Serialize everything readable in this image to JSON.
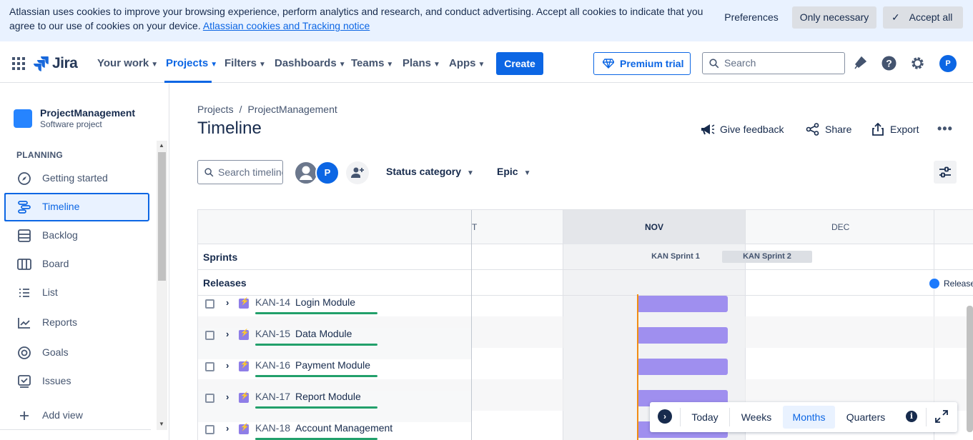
{
  "cookie_banner": {
    "text": "Atlassian uses cookies to improve your browsing experience, perform analytics and research, and conduct advertising. Accept all cookies to indicate that you agree to our use of cookies on your device.",
    "link": "Atlassian cookies and Tracking notice",
    "preferences": "Preferences",
    "only_necessary": "Only necessary",
    "accept_all": "Accept all"
  },
  "topnav": {
    "logo": "Jira",
    "items": [
      "Your work",
      "Projects",
      "Filters",
      "Dashboards",
      "Teams",
      "Plans",
      "Apps"
    ],
    "active_item": "Projects",
    "create": "Create",
    "premium": "Premium trial",
    "search_placeholder": "Search",
    "avatar": "P"
  },
  "sidebar": {
    "project_name": "ProjectManagement",
    "project_type": "Software project",
    "section": "PLANNING",
    "items": [
      {
        "label": "Getting started",
        "icon": "compass-icon"
      },
      {
        "label": "Timeline",
        "icon": "timeline-icon",
        "active": true
      },
      {
        "label": "Backlog",
        "icon": "backlog-icon"
      },
      {
        "label": "Board",
        "icon": "board-icon"
      },
      {
        "label": "List",
        "icon": "list-icon"
      },
      {
        "label": "Reports",
        "icon": "reports-icon"
      },
      {
        "label": "Goals",
        "icon": "goals-icon"
      },
      {
        "label": "Issues",
        "icon": "issues-icon"
      },
      {
        "label": "Add view",
        "icon": "plus-icon"
      }
    ]
  },
  "main": {
    "breadcrumb": [
      "Projects",
      "ProjectManagement"
    ],
    "title": "Timeline",
    "actions": {
      "feedback": "Give feedback",
      "share": "Share",
      "export": "Export"
    },
    "search_placeholder": "Search timeline",
    "avatar": "P",
    "filters": [
      "Status category",
      "Epic"
    ]
  },
  "timeline": {
    "months": [
      "T",
      "NOV",
      "DEC"
    ],
    "sprints_label": "Sprints",
    "releases_label": "Releases",
    "sprints": [
      "KAN Sprint 1",
      "KAN Sprint 2"
    ],
    "release": "Release",
    "issues": [
      {
        "key": "KAN-14",
        "summary": "Login Module"
      },
      {
        "key": "KAN-15",
        "summary": "Data Module"
      },
      {
        "key": "KAN-16",
        "summary": "Payment Module"
      },
      {
        "key": "KAN-17",
        "summary": "Report Module"
      },
      {
        "key": "KAN-18",
        "summary": "Account Management"
      }
    ]
  },
  "toolbar": {
    "today": "Today",
    "weeks": "Weeks",
    "months": "Months",
    "quarters": "Quarters",
    "selected": "Months",
    "info": "i"
  }
}
